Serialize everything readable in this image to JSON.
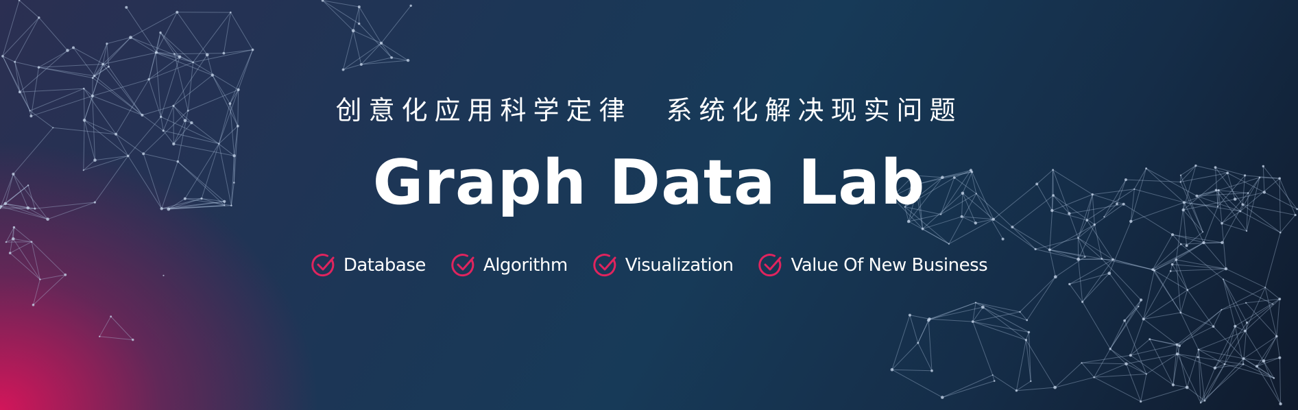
{
  "banner": {
    "tagline_left": "创意化应用科学定律",
    "tagline_right": "系统化解决现实问题",
    "title": "Graph Data Lab",
    "features": [
      {
        "label": "Database",
        "icon": "check-circle-icon"
      },
      {
        "label": "Algorithm",
        "icon": "check-circle-icon"
      },
      {
        "label": "Visualization",
        "icon": "check-circle-icon"
      },
      {
        "label": "Value Of New Business",
        "icon": "check-circle-icon"
      }
    ]
  },
  "colors": {
    "accent": "#e0245e",
    "text": "#ffffff",
    "background_dark": "#0f1c2e",
    "background_mid": "#173a58",
    "background_glow": "#dc145a"
  }
}
